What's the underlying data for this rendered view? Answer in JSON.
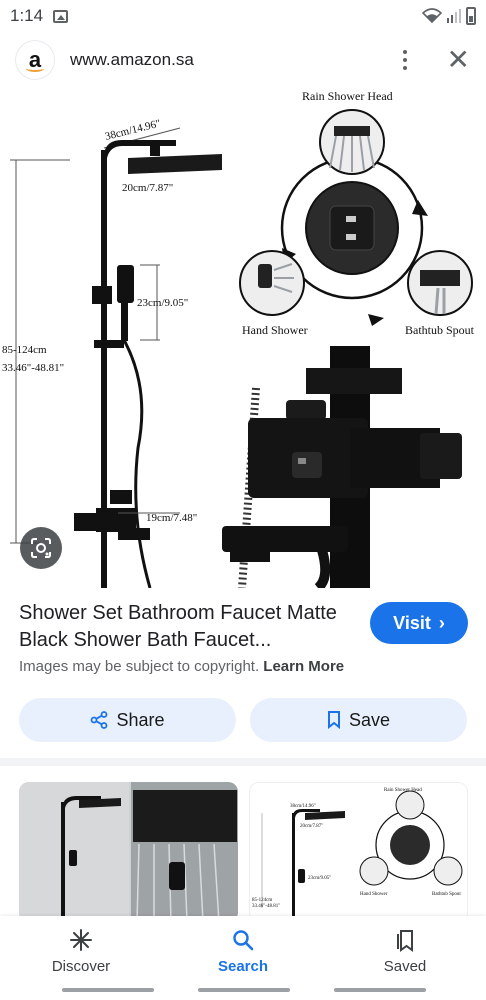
{
  "status_bar": {
    "time": "1:14"
  },
  "browser": {
    "url": "www.amazon.sa",
    "site_logo_letter": "a"
  },
  "hero_image": {
    "labels": {
      "top_width": "38cm/14.96\"",
      "head_width": "20cm/7.87\"",
      "handheld_height": "23cm/9.05\"",
      "total_height": "85-124cm",
      "total_height_in": "33.46\"-48.81\"",
      "spout_length": "19cm/7.48\"",
      "rain_shower_head": "Rain Shower Head",
      "hand_shower": "Hand Shower",
      "bathtub_spout": "Bathtub Spout"
    }
  },
  "result": {
    "title": "Shower Set Bathroom Faucet Matte Black Shower Bath Faucet...",
    "visit_label": "Visit",
    "copyright_text": "Images may be subject to copyright.",
    "learn_more": "Learn More",
    "share_label": "Share",
    "save_label": "Save"
  },
  "related": {
    "thumb2_labels": {
      "top_width": "38cm/14.96\"",
      "head_width": "20cm/7.87\"",
      "handheld_height": "23cm/9.05\"",
      "total_height": "85-124cm",
      "total_height_in": "33.46\"-48.81\"",
      "rain_shower_head": "Rain Shower Head",
      "hand_shower": "Hand Shower",
      "bathtub_spout": "Bathtub Spout"
    }
  },
  "bottom_nav": [
    {
      "label": "Discover",
      "icon": "asterisk-icon"
    },
    {
      "label": "Search",
      "icon": "search-icon"
    },
    {
      "label": "Saved",
      "icon": "bookmarks-icon"
    }
  ],
  "colors": {
    "accent": "#1a73e8",
    "chip_bg": "#e8f0fe"
  }
}
